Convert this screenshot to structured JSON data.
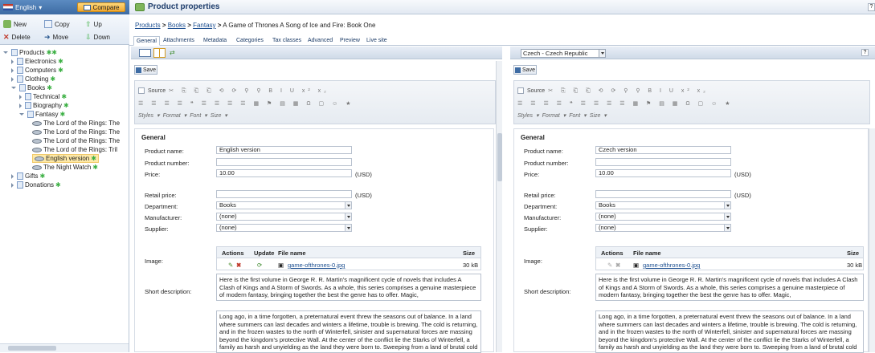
{
  "top": {
    "language": "English",
    "compare_label": "Compare"
  },
  "toolbar": {
    "new": "New",
    "copy": "Copy",
    "up": "Up",
    "delete": "Delete",
    "move": "Move",
    "down": "Down"
  },
  "tree": {
    "root": "Products",
    "items": [
      "Electronics",
      "Computers",
      "Clothing",
      "Books",
      "Technical",
      "Biography",
      "Fantasy",
      "The Lord of the Rings: The",
      "The Lord of the Rings: The",
      "The Lord of the Rings: The",
      "The Lord of the Rings: Tril",
      "English version",
      "The Night Watch",
      "Gifts",
      "Donations"
    ]
  },
  "header": {
    "title": "Product properties"
  },
  "breadcrumb": {
    "products": "Products",
    "books": "Books",
    "fantasy": "Fantasy",
    "current": "A Game of Thrones A Song of Ice and Fire: Book One"
  },
  "tabs": [
    "General",
    "Attachments",
    "Metadata",
    "Categories",
    "Tax classes",
    "Advanced",
    "Preview",
    "Live site"
  ],
  "save_label": "Save",
  "right_language": "Czech - Czech Republic",
  "editor": {
    "row1": "Source",
    "styles": "Styles",
    "format": "Format",
    "font": "Font",
    "size": "Size"
  },
  "form": {
    "legend": "General",
    "labels": {
      "product_name": "Product name:",
      "product_number": "Product number:",
      "price": "Price:",
      "retail_price": "Retail price:",
      "department": "Department:",
      "manufacturer": "Manufacturer:",
      "supplier": "Supplier:",
      "image": "Image:",
      "short_description": "Short description:"
    },
    "currency": "(USD)",
    "attach_headers": {
      "actions": "Actions",
      "update": "Update",
      "file_name": "File name",
      "size": "Size"
    },
    "file_name": "game-ofthrones-0.jpg",
    "file_size": "30 kB",
    "left": {
      "product_name": "English version",
      "price": "10.00",
      "department": "Books",
      "manufacturer": "(none)",
      "supplier": "(none)",
      "short_desc": "Here is the first volume in George R. R. Martin's magnificent cycle of novels that includes A Clash of Kings and A Storm of Swords. As a whole, this series comprises a genuine masterpiece of modern fantasy, bringing together the best the genre has to offer. Magic,",
      "long_desc": "Long ago, in a time forgotten, a preternatural event threw the seasons out of balance. In a land where summers can last decades and winters a lifetime, trouble is brewing. The cold is returning, and in the frozen wastes to the north of Winterfell, sinister and supernatural forces are massing beyond the kingdom's protective Wall. At the center of the conflict lie the Starks of Winterfell, a family as harsh and unyielding as the land they were born to. Sweeping from a land of brutal cold to"
    },
    "right": {
      "product_name": "Czech version",
      "price": "10.00",
      "department": "Books",
      "manufacturer": "(none)",
      "supplier": "(none)",
      "short_desc": "Here is the first volume in George R. R. Martin's magnificent cycle of novels that includes A Clash of Kings and A Storm of Swords. As a whole, this series comprises a genuine masterpiece of modern fantasy, bringing together the best the genre has to offer. Magic,",
      "long_desc": "Long ago, in a time forgotten, a preternatural event threw the seasons out of balance. In a land where summers can last decades and winters a lifetime, trouble is brewing. The cold is returning, and in the frozen wastes to the north of Winterfell, sinister and supernatural forces are massing beyond the kingdom's protective Wall. At the center of the conflict lie the Starks of Winterfell, a family as harsh and unyielding as the land they were born to. Sweeping from a land of brutal cold to"
    }
  },
  "colors": {
    "accent": "#3d6ba3",
    "selected": "#fde9a8",
    "published": "#3cb044"
  }
}
